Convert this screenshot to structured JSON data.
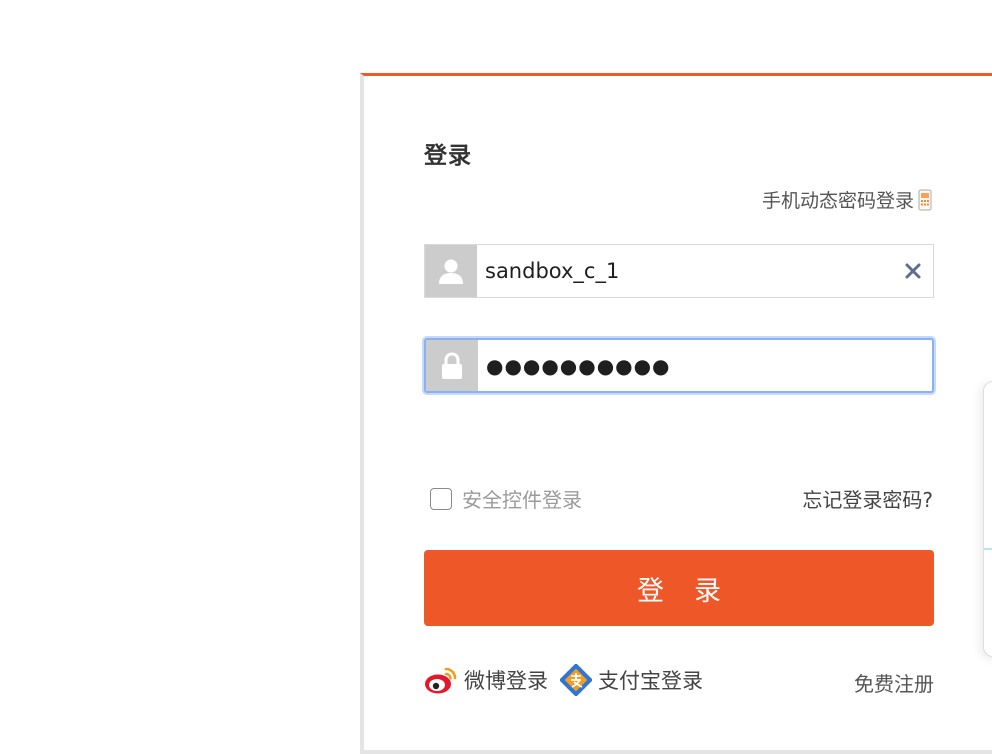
{
  "login": {
    "title": "登录",
    "phone_login_label": "手机动态密码登录",
    "username": {
      "value": "sandbox_c_1",
      "icon": "user-icon"
    },
    "password": {
      "value": "●●●●●●●●●●",
      "icon": "lock-icon"
    },
    "secure_control_label": "安全控件登录",
    "secure_control_checked": false,
    "forgot_password_label": "忘记登录密码?",
    "submit_label": "登录",
    "social": [
      {
        "label": "微博登录",
        "icon": "weibo-icon"
      },
      {
        "label": "支付宝登录",
        "icon": "alipay-icon"
      }
    ],
    "register_label": "免费注册"
  },
  "colors": {
    "accent": "#ee5728",
    "focus_border": "#8ab2f0",
    "icon_box": "#cccccc"
  }
}
